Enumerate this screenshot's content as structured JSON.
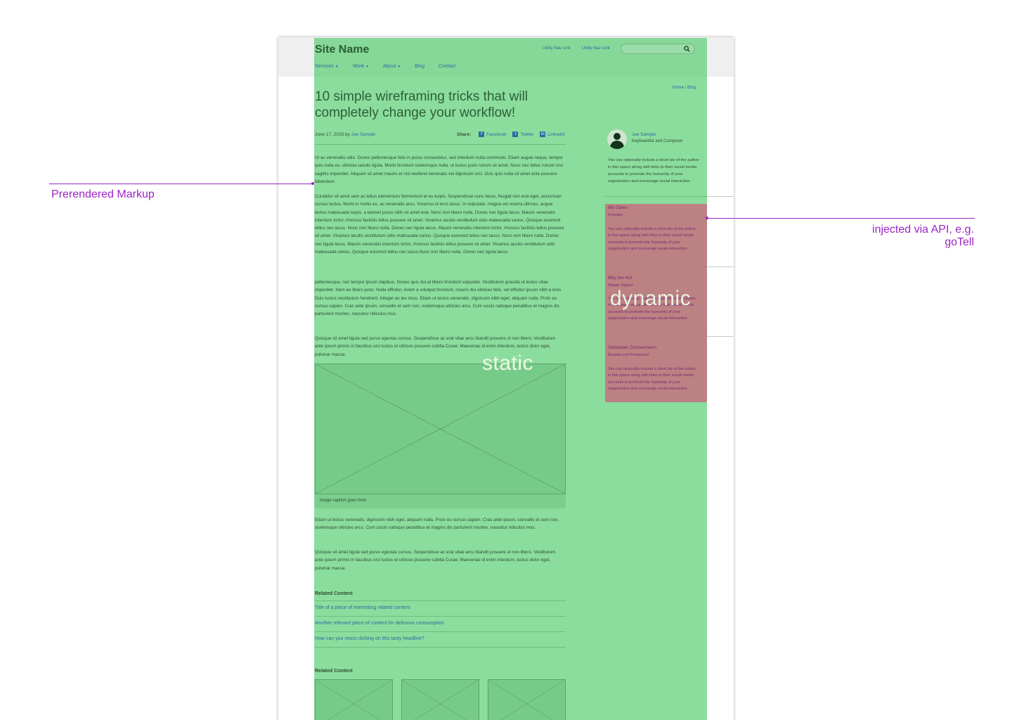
{
  "annotations": {
    "left_label": "Prerendered Markup",
    "right_label_line1": "injected via API, e.g.",
    "right_label_line2": "goTell",
    "static_label": "static",
    "dynamic_label": "dynamic"
  },
  "header": {
    "site_name": "Site Name",
    "utility_links": [
      "Utility Nav Link",
      "Utility Nav Link"
    ],
    "search_icon": "search-icon",
    "nav": [
      "Services",
      "Work",
      "About",
      "Blog",
      "Contact"
    ]
  },
  "breadcrumb": "Home / Blog",
  "article": {
    "title": "10 simple wireframing tricks that will completely change your workflow!",
    "date_by": "June 17, 2015 by",
    "author": "Joe Sample",
    "share_label": "Share:",
    "share": [
      "Facebook",
      "Twitter",
      "LinkedIn"
    ],
    "paragraphs": [
      "Ut ac venenatis odio. Donec pellentesque felis in purus consectetur, sed interdum nulla commodo. Etiam augue neque, tempor quis nulla eu, ultricies iaculis ligula. Morbi tincidunt scelerisque nulla, ut luctus justo rutrum sit amet. Nunc nec tellus rutrum orci sagittis imperdiet. Aliquam sit amet mauris et nisl eleifend venenatis vel dignissim orci. Duis quis nulla sit amet ante posuere bibendum.",
      "Curabitur sit amet sem ac tellus elementum fermentum et eu turpis. Suspendisse nunc lacus, feugiat non erat eget, accumsan cursus lectus. Morbi in mollis ex, ac venenatis arcu. Vivamus id eros lacus. In vulputate, magna vel viverra ultrices, augue lectus malesuada turpis, a laoreet purus nibh sit amet erat. Nunc non libero nulla. Donec nec ligula lacus. Mauris venenatis interdum tortor, rhoncus facilisis tellus posuere sit amet. Vivamus iaculis vestibulum odio malesuada varius. Quisque euismod tellus nec lacus. Nunc non libero nulla. Donec nec ligula lacus. Mauris venenatis interdum tortor, rhoncus facilisis tellus posuere sit amet. Vivamus iaculis vestibulum odio malesuada varius. Quisque euismod tellus nec lacus. Nunc non libero nulla. Donec nec ligula lacus. Mauris venenatis interdum tortor, rhoncus facilisis tellus posuere sit amet. Vivamus iaculis vestibulum odio malesuada varius. Quisque euismod tellus nec lacus.Nunc non libero nulla. Donec nec ligula lacus.",
      "pellentesque, nec tempor ipsum dapibus. Donec quis dui at libero tincidunt vulputate. Vestibulum gravida ut lectus vitae imperdiet. Nam eu libero justo. Nulla efficitur, lorem a volutpat tincidunt, mauris dui ultricies felis, vel efficitur ipsum nibh a eros. Duis luctus vestibulum hendrerit. Integer ac leo risus. Etiam ut lectus venenatis, dignissim nibh eget, aliquam nulla. Proin eu cursus sapien. Cras ante ipsum, convallis et sem non, scelerisque ultricies arcu. Cum sociis natoque penatibus et magnis dis parturient montes, nascetur ridiculus mus.",
      "Quisque sit amet ligula sed purus egestas cursus. Suspendisse ac erat vitae arcu blandit posuere ut non libero. Vestibulum ante ipsum primis in faucibus orci luctus et ultrices posuere cubilia Curae; Maecenas id enim interdum, luctus dolor eget, pulvinar massa."
    ],
    "image_caption": "Image caption goes here",
    "paragraphs_after": [
      "Etiam ut lectus venenatis, dignissim nibh eget, aliquam nulla. Proin eu cursus sapien. Cras ante ipsum, convallis et sem non, scelerisque ultricies arcu. Cum sociis natoque penatibus et magnis dis parturient montes, nascetur ridiculus mus.",
      "Quisque sit amet ligula sed purus egestas cursus. Suspendisse ac erat vitae arcu blandit posuere ut non libero. Vestibulum ante ipsum primis in faucibus orci luctus et ultrices posuere cubilia Curae; Maecenas id enim interdum, luctus dolor eget, pulvinar massa."
    ]
  },
  "related": {
    "title": "Related Content",
    "links": [
      "Title of a piece of interesting related content",
      "Another relevant piece of content for delicious consumption",
      "How can you resist clicking on this tasty headline?"
    ],
    "title2": "Related Content"
  },
  "sidebar": {
    "author_name": "Joe Sample",
    "author_role": "Keyboardist and Composer",
    "author_bio": "You can optionally include a short bio of the author in this space along with links to their social media accounts to promote the humanity of your organization and encourage social interaction.",
    "dynamic_authors": [
      {
        "name": "Bill Gates",
        "role": "Founder",
        "bio": "You can optionally include a short bio of the author in this space along with links to their social media accounts to promote the humanity of your organization and encourage social interaction."
      },
      {
        "name": "Billy the Kid",
        "role": "Ripper Ripper",
        "bio": "You can optionally include a short bio of the author in this space along with links to their social media accounts to promote the humanity of your organization and encourage social interaction."
      },
      {
        "name": "Sebastian Zimmermann",
        "role": "Bassist und Produzent",
        "bio": "You can optionally include a short bio of the author in this space along with links to their social media accounts to promote the humanity of your organization and encourage social interaction."
      }
    ]
  },
  "colors": {
    "annotation": "#9b24c4",
    "static_overlay": "#5ace73",
    "dynamic_overlay": "#d25a78",
    "link": "#2e6aa0"
  }
}
